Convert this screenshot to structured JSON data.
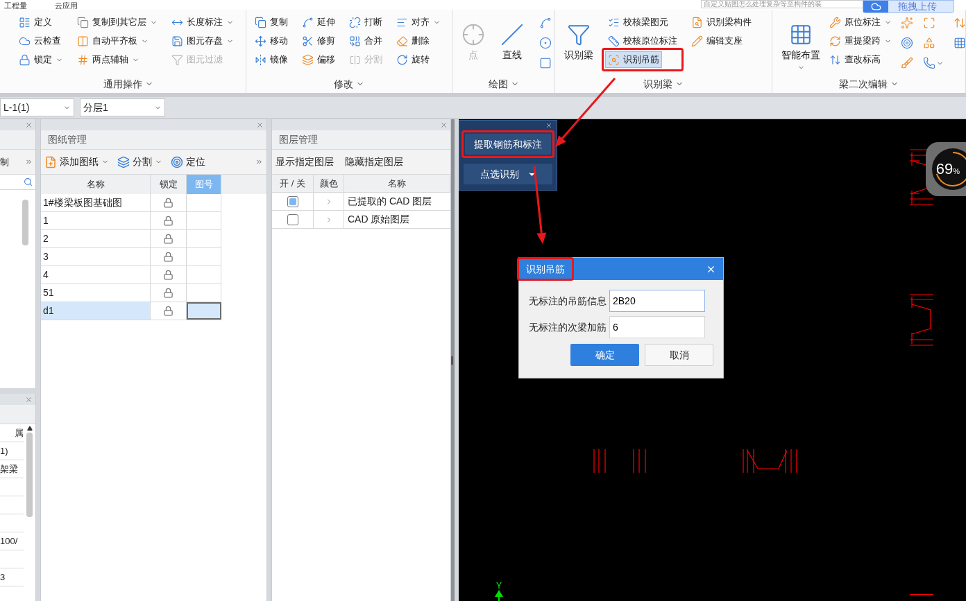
{
  "menu_tabs": [
    {
      "label": "工程量"
    },
    {
      "label": "云应用"
    }
  ],
  "search": {
    "placeholder": "自定义贴图怎么处理复杂等至构件的装"
  },
  "upload_button": "拖拽上传",
  "ribbon": [
    {
      "title": "通用操作",
      "columns": [
        {
          "kind": "stack",
          "items": [
            {
              "label": "定义",
              "dropdown": false,
              "disabled": false,
              "active": false,
              "highlighted": false
            },
            {
              "label": "云检查",
              "dropdown": false,
              "disabled": false,
              "active": false,
              "highlighted": false
            },
            {
              "label": "锁定",
              "dropdown": true,
              "disabled": false,
              "active": false,
              "highlighted": false
            }
          ]
        },
        {
          "kind": "stack",
          "items": [
            {
              "label": "复制到其它层",
              "dropdown": true,
              "disabled": false,
              "active": false,
              "highlighted": false
            },
            {
              "label": "自动平齐板",
              "dropdown": true,
              "disabled": false,
              "active": false,
              "highlighted": false
            },
            {
              "label": "两点辅轴",
              "dropdown": true,
              "disabled": false,
              "active": false,
              "highlighted": false
            }
          ]
        },
        {
          "kind": "stack",
          "items": [
            {
              "label": "长度标注",
              "dropdown": true,
              "disabled": false,
              "active": false,
              "highlighted": false
            },
            {
              "label": "图元存盘",
              "dropdown": true,
              "disabled": false,
              "active": false,
              "highlighted": false
            },
            {
              "label": "图元过滤",
              "dropdown": false,
              "disabled": true,
              "active": false,
              "highlighted": false
            }
          ]
        }
      ]
    },
    {
      "title": "修改",
      "columns": [
        {
          "kind": "stack",
          "items": [
            {
              "label": "复制",
              "dropdown": false,
              "disabled": false,
              "active": false,
              "highlighted": false
            },
            {
              "label": "移动",
              "dropdown": false,
              "disabled": false,
              "active": false,
              "highlighted": false
            },
            {
              "label": "镜像",
              "dropdown": false,
              "disabled": false,
              "active": false,
              "highlighted": false
            }
          ]
        },
        {
          "kind": "stack",
          "items": [
            {
              "label": "延伸",
              "dropdown": false,
              "disabled": false,
              "active": false,
              "highlighted": false
            },
            {
              "label": "修剪",
              "dropdown": false,
              "disabled": false,
              "active": false,
              "highlighted": false
            },
            {
              "label": "偏移",
              "dropdown": false,
              "disabled": false,
              "active": false,
              "highlighted": false
            }
          ]
        },
        {
          "kind": "stack",
          "items": [
            {
              "label": "打断",
              "dropdown": false,
              "disabled": false,
              "active": false,
              "highlighted": false
            },
            {
              "label": "合并",
              "dropdown": false,
              "disabled": false,
              "active": false,
              "highlighted": false
            },
            {
              "label": "分割",
              "dropdown": false,
              "disabled": true,
              "active": false,
              "highlighted": false
            }
          ]
        },
        {
          "kind": "stack",
          "items": [
            {
              "label": "对齐",
              "dropdown": true,
              "disabled": false,
              "active": false,
              "highlighted": false
            },
            {
              "label": "删除",
              "dropdown": false,
              "disabled": false,
              "active": false,
              "highlighted": false
            },
            {
              "label": "旋转",
              "dropdown": false,
              "disabled": false,
              "active": false,
              "highlighted": false
            }
          ]
        }
      ]
    },
    {
      "title": "绘图",
      "columns": [
        {
          "kind": "large",
          "items": [
            {
              "label": "点",
              "dropdown": false,
              "disabled": true,
              "active": false,
              "highlighted": false
            }
          ]
        },
        {
          "kind": "large",
          "items": [
            {
              "label": "直线",
              "dropdown": false,
              "disabled": false,
              "active": false,
              "highlighted": false
            }
          ]
        },
        {
          "kind": "stack",
          "items": [
            {
              "dropdown": false
            },
            {
              "dropdown": false
            },
            {
              "dropdown": false
            }
          ]
        }
      ]
    },
    {
      "title": "识别梁",
      "columns": [
        {
          "kind": "large",
          "items": [
            {
              "label": "识别梁",
              "dropdown": false,
              "disabled": false,
              "active": false,
              "highlighted": false
            }
          ]
        },
        {
          "kind": "stack",
          "items": [
            {
              "label": "校核梁图元",
              "dropdown": false,
              "disabled": false,
              "active": false,
              "highlighted": false
            },
            {
              "label": "校核原位标注",
              "dropdown": false,
              "disabled": false,
              "active": false,
              "highlighted": false
            },
            {
              "label": "识别吊筋",
              "dropdown": false,
              "disabled": false,
              "active": true,
              "highlighted": true
            }
          ]
        },
        {
          "kind": "stack",
          "items": [
            {
              "label": "识别梁构件",
              "dropdown": false,
              "disabled": false,
              "active": false,
              "highlighted": false
            },
            {
              "label": "编辑支座",
              "dropdown": false,
              "disabled": false,
              "active": false,
              "highlighted": false
            }
          ]
        }
      ]
    },
    {
      "title": "梁二次编辑",
      "columns": [
        {
          "kind": "large",
          "items": [
            {
              "label": "智能布置",
              "dropdown": true,
              "disabled": false,
              "active": false,
              "highlighted": false
            }
          ]
        },
        {
          "kind": "stack",
          "items": [
            {
              "label": "原位标注",
              "dropdown": true,
              "disabled": false,
              "active": false,
              "highlighted": false
            },
            {
              "label": "重提梁跨",
              "dropdown": true,
              "disabled": false,
              "active": false,
              "highlighted": false
            },
            {
              "label": "查改标高",
              "dropdown": false,
              "disabled": false,
              "active": false,
              "highlighted": false
            }
          ]
        },
        {
          "kind": "stack",
          "items": [
            {
              "dropdown": false
            },
            {
              "dropdown": false
            },
            {
              "dropdown": false
            }
          ]
        },
        {
          "kind": "stack",
          "items": [
            {
              "dropdown": false
            },
            {
              "dropdown": false
            },
            {
              "dropdown": true
            }
          ]
        },
        {
          "kind": "stack",
          "items": [
            {
              "dropdown": false
            },
            {
              "dropdown": false
            }
          ]
        }
      ]
    }
  ],
  "selectors": [
    {
      "value": "L-1(1)"
    },
    {
      "value": "分层1"
    }
  ],
  "left_panel": {
    "tool": "制",
    "column": "属",
    "rows": [
      "1)",
      "架梁",
      null,
      null,
      null,
      "100/",
      null,
      "3"
    ]
  },
  "drawings_panel": {
    "title": "图纸管理",
    "tools": [
      {
        "label": "添加图纸",
        "dropdown": true
      },
      {
        "label": "分割",
        "dropdown": true
      },
      {
        "label": "定位",
        "dropdown": false
      }
    ],
    "columns": [
      {
        "label": "名称",
        "selected": false
      },
      {
        "label": "锁定",
        "selected": false
      },
      {
        "label": "图号",
        "selected": true
      }
    ],
    "rows": [
      {
        "name": "1#楼梁板图基础图",
        "locked": true,
        "selected": false
      },
      {
        "name": "1",
        "locked": true,
        "selected": false
      },
      {
        "name": "2",
        "locked": true,
        "selected": false
      },
      {
        "name": "3",
        "locked": true,
        "selected": false
      },
      {
        "name": "4",
        "locked": true,
        "selected": false
      },
      {
        "name": "51",
        "locked": true,
        "selected": false
      },
      {
        "name": "d1",
        "locked": true,
        "selected": true
      }
    ]
  },
  "layers_panel": {
    "title": "图层管理",
    "tools": [
      "显示指定图层",
      "隐藏指定图层"
    ],
    "columns": [
      "开 / 关",
      "颜色",
      "名称"
    ],
    "rows": [
      {
        "name": "已提取的 CAD 图层",
        "checked": true
      },
      {
        "name": "CAD 原始图层",
        "checked": false
      }
    ]
  },
  "float_panel": {
    "buttons": [
      {
        "label": "提取钢筋和标注",
        "dropdown": false,
        "highlighted": true
      },
      {
        "label": "点选识别",
        "dropdown": true,
        "highlighted": false
      }
    ]
  },
  "dialog": {
    "title": "识别吊筋",
    "title_highlighted": true,
    "fields": [
      {
        "label": "无标注的吊筋信息",
        "value": "2B20",
        "focused": true
      },
      {
        "label": "无标注的次梁加筋",
        "value": "6",
        "focused": false
      }
    ],
    "buttons": [
      {
        "label": "确定",
        "primary": true
      },
      {
        "label": "取消",
        "primary": false
      }
    ]
  },
  "meter": {
    "value": "69",
    "unit": "%"
  },
  "axis_label": "Y"
}
